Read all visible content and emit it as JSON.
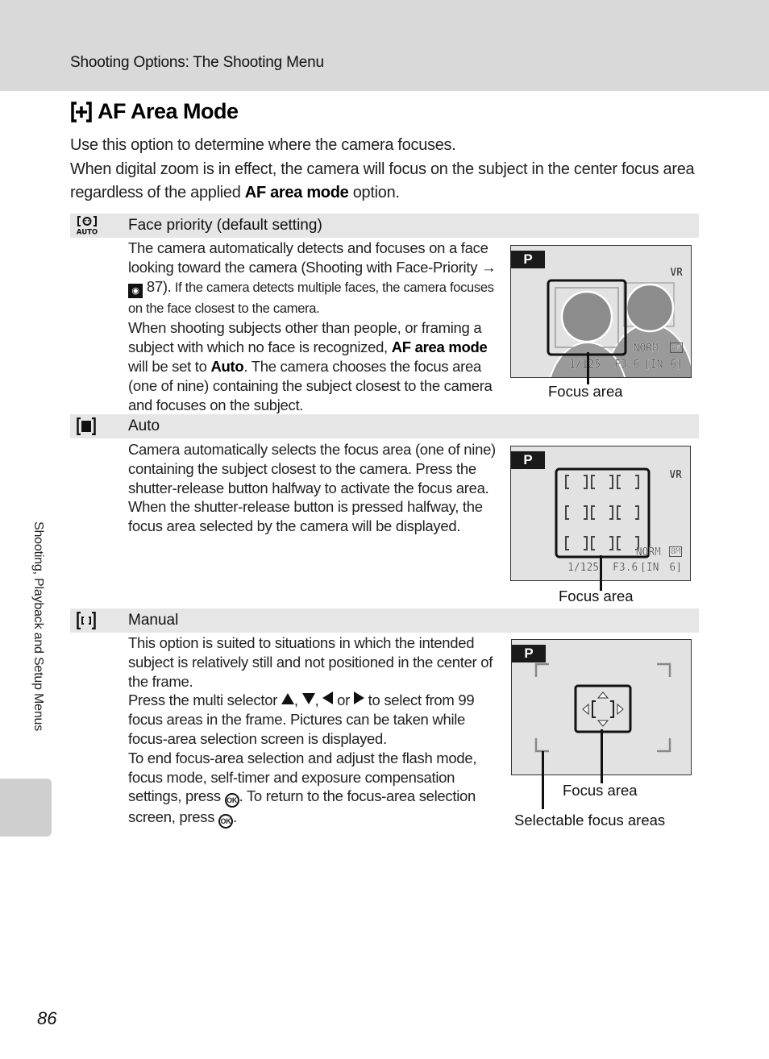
{
  "header": {
    "section_title": "Shooting Options: The Shooting Menu"
  },
  "page": {
    "title_icon": "af-area-mode-icon",
    "title": "AF Area Mode",
    "intro_line1": "Use this option to determine where the camera focuses.",
    "intro_line2_pre": "When digital zoom is in effect, the camera will focus on the subject in the center focus area regardless of the applied ",
    "intro_line2_bold": "AF area mode",
    "intro_line2_post": " option.",
    "number": "86"
  },
  "side_tab": {
    "label": "Shooting, Playback and Setup Menus"
  },
  "options": [
    {
      "icon": "face-priority-icon",
      "label": "Face priority (default setting)",
      "body": {
        "p1_a": "The camera automatically detects and focuses on a face looking toward the camera (Shooting with Face-Priority ",
        "p1_arrow": "→",
        "p1_ref": "87).",
        "p1_small": " If the camera detects multiple faces, the camera focuses on the face closest to the camera.",
        "p2_a": "When shooting subjects other than people, or framing a subject with which no face is recognized, ",
        "p2_bold1": "AF area mode",
        "p2_b": " will be set to ",
        "p2_bold2": "Auto",
        "p2_c": ". The camera chooses the focus area (one of nine) containing the subject closest to the camera and focuses on the subject."
      },
      "screen": {
        "mode": "P",
        "vr": "VR",
        "quality": "NORM",
        "size": "8M",
        "shutter": "1/125",
        "aperture": "F3.6",
        "memory": "[IN",
        "shots": "6]"
      },
      "callouts": [
        "Focus area"
      ]
    },
    {
      "icon": "auto-area-icon",
      "label": "Auto",
      "body": {
        "text": "Camera automatically selects the focus area (one of nine) containing the subject closest to the camera. Press the shutter-release button halfway to activate the focus area. When the shutter-release button is pressed halfway, the focus area selected by the camera will be displayed."
      },
      "screen": {
        "mode": "P",
        "vr": "VR",
        "quality": "NORM",
        "size": "8M",
        "shutter": "1/125",
        "aperture": "F3.6",
        "memory": "[IN",
        "shots": "6]",
        "grid": "3x3"
      },
      "callouts": [
        "Focus area"
      ]
    },
    {
      "icon": "manual-area-icon",
      "label": "Manual",
      "body": {
        "p1": "This option is suited to situations in which the intended subject is relatively still and not positioned in the center of the frame.",
        "p2_a": "Press the multi selector ",
        "p2_sep1": ", ",
        "p2_sep2": ", ",
        "p2_or": " or ",
        "p2_b": " to select from 99 focus areas in the frame. Pictures can be taken while focus-area selection screen is displayed.",
        "p3_a": "To end focus-area selection and adjust the flash mode, focus mode, self-timer and exposure compensation settings, press ",
        "p3_ok": "OK",
        "p3_b": ". To return to the focus-area selection screen, press ",
        "p3_c": "."
      },
      "screen": {
        "mode": "P"
      },
      "callouts": [
        "Focus area",
        "Selectable focus areas"
      ]
    }
  ]
}
